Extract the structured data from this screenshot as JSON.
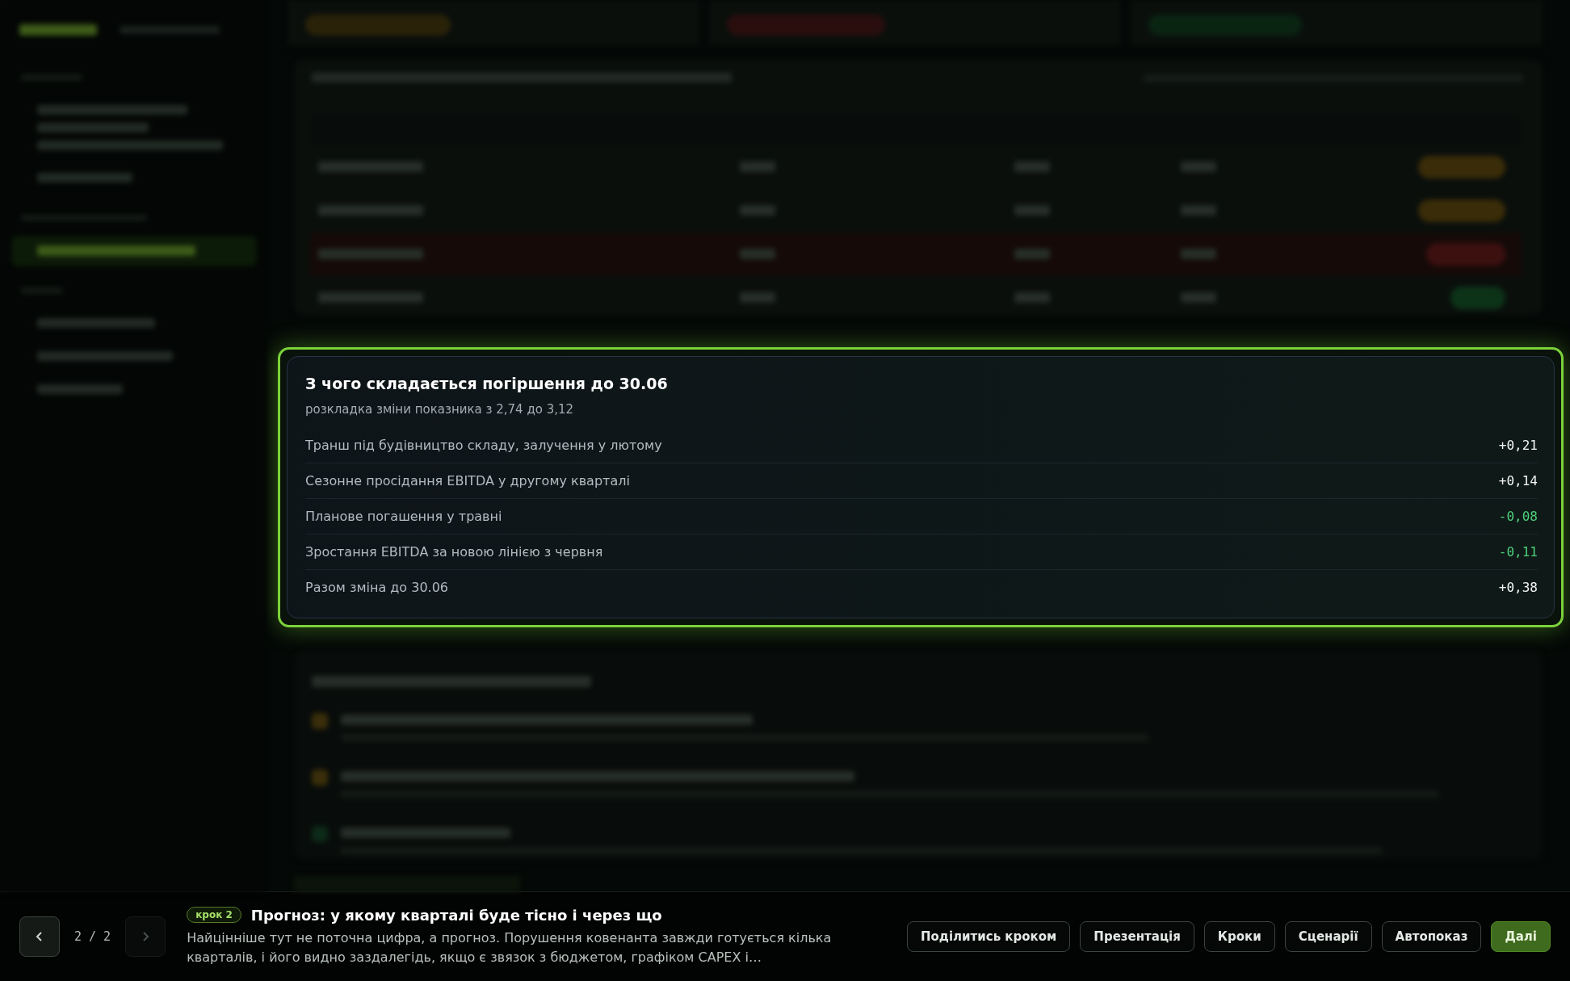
{
  "breakdown": {
    "title": "З чого складається погіршення до 30.06",
    "subtitle": "розкладка зміни показника з 2,74 до 3,12",
    "rows": [
      {
        "label": "Транш під будівництво складу, залучення у лютому",
        "value": "+0,21",
        "kind": "increase"
      },
      {
        "label": "Сезонне просідання EBITDA у другому кварталі",
        "value": "+0,14",
        "kind": "increase"
      },
      {
        "label": "Планове погашення у травні",
        "value": "-0,08",
        "kind": "decrease"
      },
      {
        "label": "Зростання EBITDA за новою лінією з червня",
        "value": "-0,11",
        "kind": "decrease"
      },
      {
        "label": "Разом зміна до 30.06",
        "value": "+0,38",
        "kind": "increase"
      }
    ]
  },
  "tour": {
    "counter": "2 / 2",
    "step": "крок 2",
    "title": "Прогноз: у якому кварталі буде тісно і через що",
    "text": "Найцінніше тут не поточна цифра, а прогноз. Порушення ковенанта завжди готується кілька кварталів, і його видно заздалегідь, якщо є звязок з бюджетом, графіком CAPEX і…",
    "buttons": [
      {
        "label": "Поділитись кроком",
        "primary": false
      },
      {
        "label": "Презентація",
        "primary": false
      },
      {
        "label": "Кроки",
        "primary": false
      },
      {
        "label": "Сценарії",
        "primary": false
      },
      {
        "label": "Автопоказ",
        "primary": false
      },
      {
        "label": "Далі",
        "primary": true
      }
    ]
  }
}
